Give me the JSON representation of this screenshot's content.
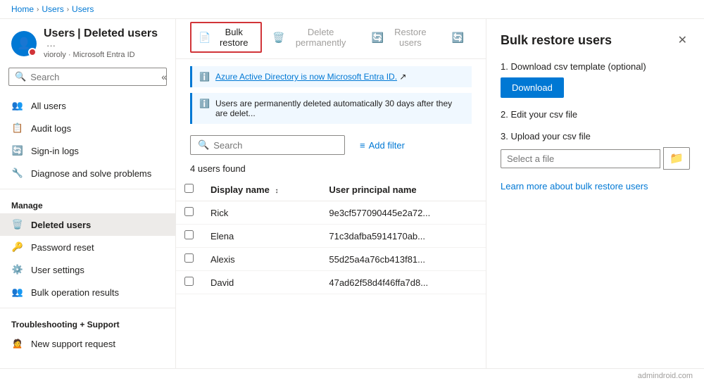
{
  "breadcrumb": {
    "items": [
      "Home",
      "Users",
      "Users"
    ]
  },
  "sidebar": {
    "avatar_icon": "👤",
    "title": "Users",
    "page_title": "Deleted users",
    "subtitle": "vioroly · Microsoft Entra ID",
    "more_label": "···",
    "search_placeholder": "Search",
    "collapse_icon": "«",
    "nav_items": [
      {
        "id": "all-users",
        "label": "All users",
        "icon": "👥"
      },
      {
        "id": "audit-logs",
        "label": "Audit logs",
        "icon": "📋"
      },
      {
        "id": "sign-in-logs",
        "label": "Sign-in logs",
        "icon": "🔄"
      },
      {
        "id": "diagnose",
        "label": "Diagnose and solve problems",
        "icon": "🔧"
      }
    ],
    "manage_section": "Manage",
    "manage_items": [
      {
        "id": "deleted-users",
        "label": "Deleted users",
        "icon": "🗑️",
        "active": true
      },
      {
        "id": "password-reset",
        "label": "Password reset",
        "icon": "🔑"
      },
      {
        "id": "user-settings",
        "label": "User settings",
        "icon": "⚙️"
      },
      {
        "id": "bulk-operation",
        "label": "Bulk operation results",
        "icon": "👥"
      }
    ],
    "troubleshooting_section": "Troubleshooting + Support",
    "support_items": [
      {
        "id": "new-support",
        "label": "New support request",
        "icon": "🙍"
      }
    ]
  },
  "toolbar": {
    "bulk_restore_label": "Bulk restore",
    "bulk_restore_icon": "📄",
    "delete_perm_label": "Delete permanently",
    "delete_perm_icon": "🗑️",
    "restore_users_label": "Restore users",
    "restore_users_icon": "🔄",
    "refresh_icon": "🔄"
  },
  "info_bar_1": {
    "text": "Azure Active Directory is now Microsoft Entra ID.",
    "link_text": "Azure Active Directory is now Microsoft Entra ID.",
    "external_icon": "↗"
  },
  "info_bar_2": {
    "text": "Users are permanently deleted automatically 30 days after they are delet..."
  },
  "filter": {
    "search_placeholder": "Search",
    "add_filter_label": "Add filter",
    "filter_icon": "≡"
  },
  "table": {
    "users_found": "4 users found",
    "columns": [
      "Display name",
      "User principal name"
    ],
    "rows": [
      {
        "name": "Rick",
        "upn": "9e3cf577090445e2a72..."
      },
      {
        "name": "Elena",
        "upn": "71c3dafba5914170ab..."
      },
      {
        "name": "Alexis",
        "upn": "55d25a4a76cb413f81..."
      },
      {
        "name": "David",
        "upn": "47ad62f58d4f46ffa7d8..."
      }
    ]
  },
  "right_panel": {
    "title": "Bulk restore users",
    "close_icon": "✕",
    "step1_label": "1. Download csv template (optional)",
    "download_btn_label": "Download",
    "step2_label": "2. Edit your csv file",
    "step3_label": "3. Upload your csv file",
    "file_placeholder": "Select a file",
    "browse_icon": "📁",
    "learn_more_text": "Learn more about bulk restore users"
  },
  "footer": {
    "watermark": "admindroid.com"
  }
}
